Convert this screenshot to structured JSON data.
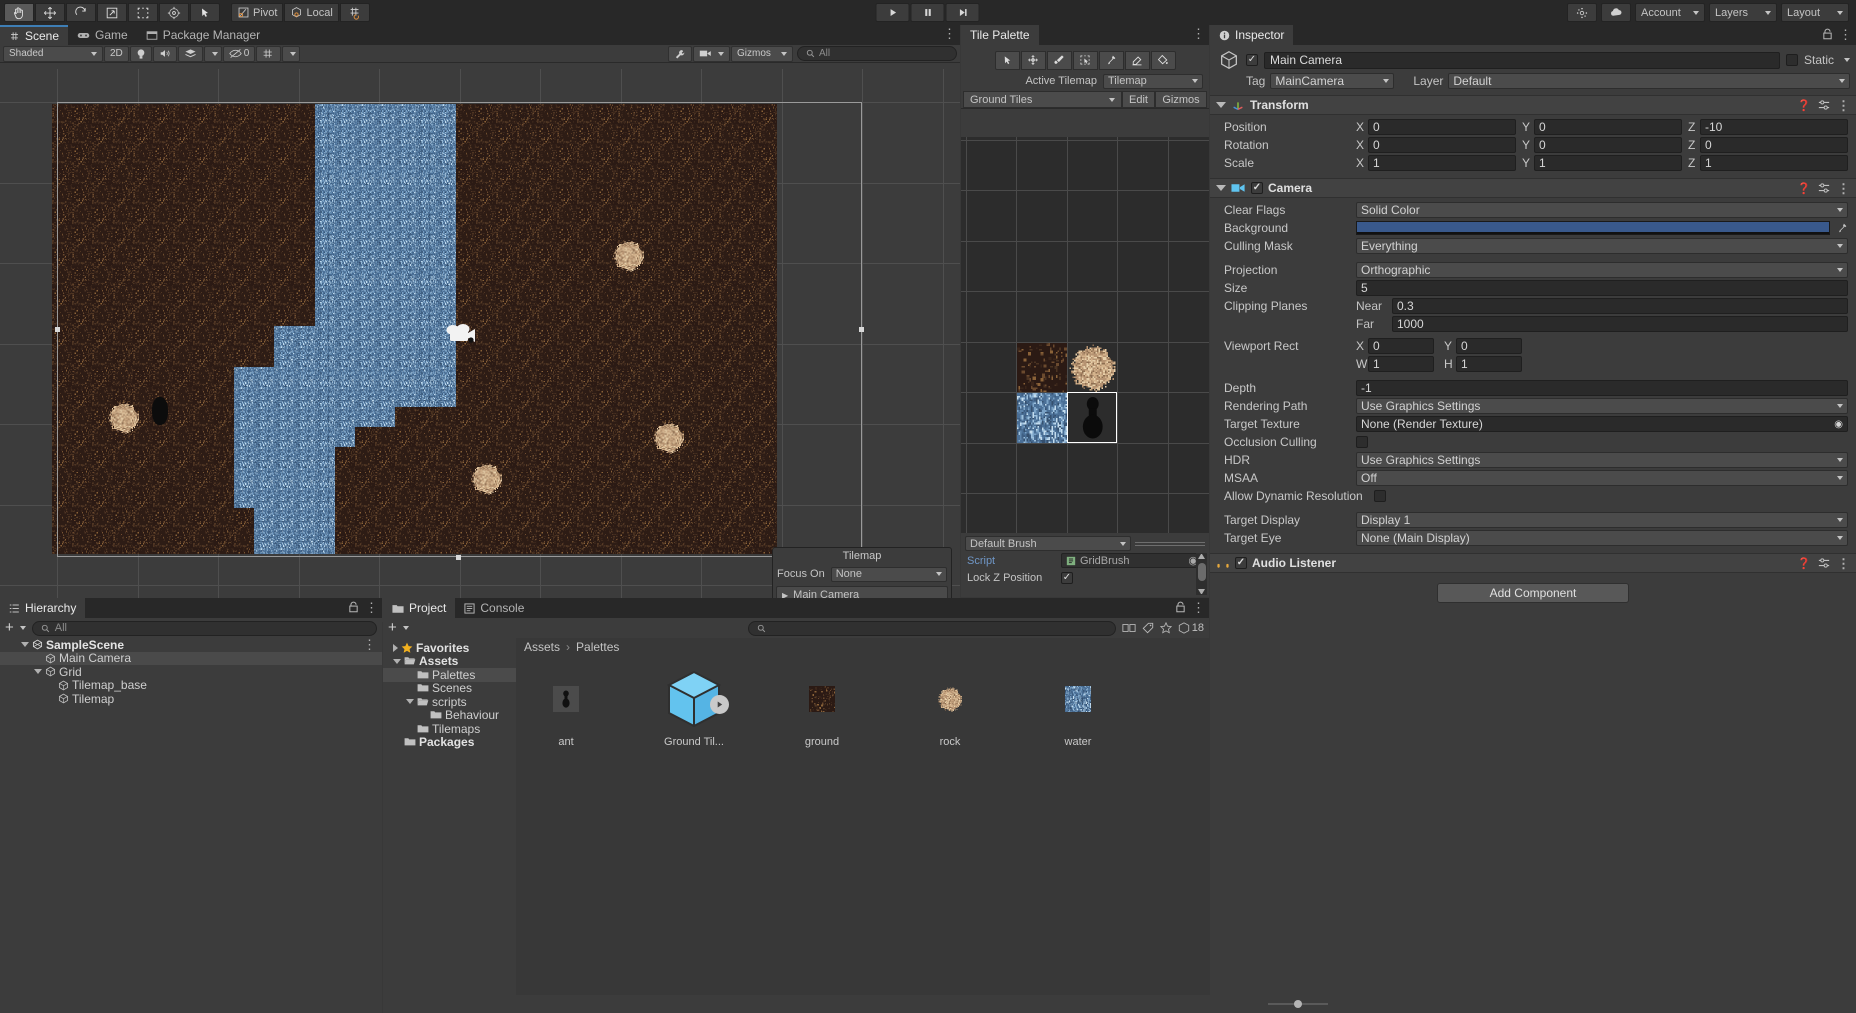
{
  "toolbar": {
    "tools": [
      {
        "name": "hand-tool",
        "icon": "hand-icon",
        "active": true
      },
      {
        "name": "move-tool",
        "icon": "move-icon",
        "active": false
      },
      {
        "name": "rotate-tool",
        "icon": "rotate-icon",
        "active": false
      },
      {
        "name": "scale-tool",
        "icon": "scale-icon",
        "active": false
      },
      {
        "name": "rect-tool",
        "icon": "rect-icon",
        "active": false
      },
      {
        "name": "transform-tool",
        "icon": "transform-icon",
        "active": false
      },
      {
        "name": "custom-tool",
        "icon": "cursor-icon",
        "active": false
      }
    ],
    "pivot_label": "Pivot",
    "space_label": "Local",
    "grid_snap_icon": "grid-snap-icon",
    "play_label": "play-icon",
    "pause_label": "pause-icon",
    "step_label": "step-icon",
    "cloud_icon": "cloud-icon",
    "search_service_icon": "services-icon",
    "account_label": "Account",
    "layers_label": "Layers",
    "layout_label": "Layout"
  },
  "scene": {
    "tabs": [
      {
        "label": "Scene",
        "icon": "scene-icon",
        "selected": true
      },
      {
        "label": "Game",
        "icon": "game-icon",
        "selected": false
      },
      {
        "label": "Package Manager",
        "icon": "package-icon",
        "selected": false
      }
    ],
    "shading_mode": "Shaded",
    "mode_2d": "2D",
    "lighting_icon": "light-bulb-icon",
    "audio_icon": "speaker-icon",
    "fx_icon": "effects-icon",
    "hidden_count": "0",
    "grid_icon": "grid-visibility-icon",
    "gizmos_label": "Gizmos",
    "search_placeholder": "All"
  },
  "tilemap_overlay": {
    "title": "Tilemap",
    "focus_on_label": "Focus On",
    "focus_on_value": "None",
    "selected_object": "Main Camera"
  },
  "tile_palette": {
    "tab_label": "Tile Palette",
    "tools": [
      "select-icon",
      "move-icon",
      "paint-brush-icon",
      "box-fill-icon",
      "picker-icon",
      "eraser-icon",
      "fill-icon"
    ],
    "active_tilemap_label": "Active Tilemap",
    "active_tilemap_value": "Tilemap",
    "palette_name": "Ground Tiles",
    "edit_label": "Edit",
    "gizmos_label": "Gizmos",
    "brush_label": "Default Brush",
    "script_label": "Script",
    "script_value": "GridBrush",
    "lock_z_label": "Lock Z Position",
    "lock_z_checked": true
  },
  "inspector": {
    "tab_label": "Inspector",
    "lock_icon": "lock-icon",
    "object_name": "Main Camera",
    "object_enabled": true,
    "static_label": "Static",
    "tag_label": "Tag",
    "tag_value": "MainCamera",
    "layer_label": "Layer",
    "layer_value": "Default",
    "transform": {
      "title": "Transform",
      "rows": [
        {
          "label": "Position",
          "x": "0",
          "y": "0",
          "z": "-10"
        },
        {
          "label": "Rotation",
          "x": "0",
          "y": "0",
          "z": "0"
        },
        {
          "label": "Scale",
          "x": "1",
          "y": "1",
          "z": "1"
        }
      ]
    },
    "camera": {
      "title": "Camera",
      "enabled": true,
      "clear_flags_label": "Clear Flags",
      "clear_flags_value": "Solid Color",
      "background_label": "Background",
      "background_color": "#39598c",
      "culling_mask_label": "Culling Mask",
      "culling_mask_value": "Everything",
      "projection_label": "Projection",
      "projection_value": "Orthographic",
      "size_label": "Size",
      "size_value": "5",
      "clipping_label": "Clipping Planes",
      "near_label": "Near",
      "near_value": "0.3",
      "far_label": "Far",
      "far_value": "1000",
      "viewport_label": "Viewport Rect",
      "viewport_x": "0",
      "viewport_y": "0",
      "viewport_w": "1",
      "viewport_h": "1",
      "depth_label": "Depth",
      "depth_value": "-1",
      "rendering_path_label": "Rendering Path",
      "rendering_path_value": "Use Graphics Settings",
      "target_texture_label": "Target Texture",
      "target_texture_value": "None (Render Texture)",
      "occlusion_label": "Occlusion Culling",
      "occlusion_checked": false,
      "hdr_label": "HDR",
      "hdr_value": "Use Graphics Settings",
      "msaa_label": "MSAA",
      "msaa_value": "Off",
      "dynamic_res_label": "Allow Dynamic Resolution",
      "dynamic_res_checked": false,
      "target_display_label": "Target Display",
      "target_display_value": "Display 1",
      "target_eye_label": "Target Eye",
      "target_eye_value": "None (Main Display)"
    },
    "audio_listener": {
      "title": "Audio Listener",
      "enabled": true,
      "icon": "headphones-icon"
    },
    "add_component_label": "Add Component"
  },
  "hierarchy": {
    "tab_label": "Hierarchy",
    "search_placeholder": "All",
    "items": [
      {
        "label": "SampleScene",
        "depth": 0,
        "icon": "scene-asset-icon",
        "expanded": true,
        "selected": false
      },
      {
        "label": "Main Camera",
        "depth": 1,
        "icon": "gameobject-icon",
        "expanded": false,
        "selected": true
      },
      {
        "label": "Grid",
        "depth": 1,
        "icon": "gameobject-icon",
        "expanded": true,
        "selected": false
      },
      {
        "label": "Tilemap_base",
        "depth": 2,
        "icon": "gameobject-icon",
        "expanded": false,
        "selected": false
      },
      {
        "label": "Tilemap",
        "depth": 2,
        "icon": "gameobject-icon",
        "expanded": false,
        "selected": false
      }
    ]
  },
  "project": {
    "tabs": [
      {
        "label": "Project",
        "icon": "folder-icon",
        "selected": true
      },
      {
        "label": "Console",
        "icon": "console-icon",
        "selected": false
      }
    ],
    "search_placeholder": "",
    "badge_count": "18",
    "tree": [
      {
        "label": "Favorites",
        "depth": 0,
        "icon": "star-icon",
        "expanded": false,
        "selected": false
      },
      {
        "label": "Assets",
        "depth": 0,
        "icon": "folder-open-icon",
        "expanded": true,
        "selected": false
      },
      {
        "label": "Palettes",
        "depth": 1,
        "icon": "folder-icon",
        "expanded": false,
        "selected": true
      },
      {
        "label": "Scenes",
        "depth": 1,
        "icon": "folder-icon",
        "expanded": false,
        "selected": false
      },
      {
        "label": "scripts",
        "depth": 1,
        "icon": "folder-open-icon",
        "expanded": true,
        "selected": false
      },
      {
        "label": "Behaviour",
        "depth": 2,
        "icon": "folder-icon",
        "expanded": false,
        "selected": false
      },
      {
        "label": "Tilemaps",
        "depth": 1,
        "icon": "folder-icon",
        "expanded": false,
        "selected": false
      },
      {
        "label": "Packages",
        "depth": 0,
        "icon": "folder-icon",
        "expanded": false,
        "selected": false
      }
    ],
    "breadcrumb": [
      "Assets",
      "Palettes"
    ],
    "assets": [
      {
        "label": "ant",
        "type": "sprite-dark"
      },
      {
        "label": "Ground Til...",
        "type": "prefab-cube"
      },
      {
        "label": "ground",
        "type": "tile-ground"
      },
      {
        "label": "rock",
        "type": "tile-rock"
      },
      {
        "label": "water",
        "type": "tile-water"
      }
    ]
  }
}
